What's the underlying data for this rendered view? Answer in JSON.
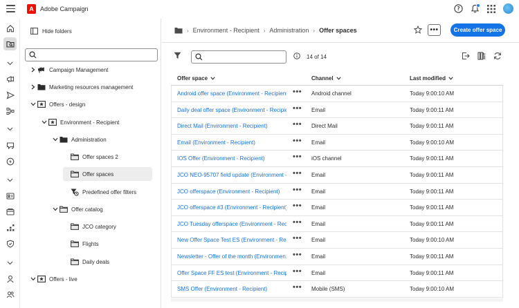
{
  "app": {
    "title": "Adobe Campaign",
    "logo_letter": "A"
  },
  "header_icons": [
    "help-icon",
    "notifications-icon",
    "apps-grid-icon",
    "avatar"
  ],
  "rail": [
    "home-icon",
    "explorer-icon",
    "chevron-down-icon",
    "campaigns-icon",
    "send-icon",
    "journeys-icon",
    "chevron-down-icon",
    "offers-icon",
    "decisioning-icon",
    "chevron-down-icon",
    "profiles-icon",
    "audiences-icon",
    "workflows-icon",
    "security-icon",
    "chevron-down-icon",
    "person-icon",
    "people-icon"
  ],
  "folder_panel": {
    "hide_label": "Hide folders",
    "tree": [
      {
        "label": "Campaign Management",
        "level": 0,
        "expanded": false,
        "icon": "campaign-folder-icon"
      },
      {
        "label": "Marketing resources management",
        "level": 0,
        "expanded": false,
        "icon": "folder-icon"
      },
      {
        "label": "Offers - design",
        "level": 0,
        "expanded": true,
        "icon": "offer-folder-icon"
      },
      {
        "label": "Environment - Recipient",
        "level": 1,
        "expanded": true,
        "icon": "offer-folder-icon"
      },
      {
        "label": "Administration",
        "level": 2,
        "expanded": true,
        "icon": "folder-icon"
      },
      {
        "label": "Offer spaces 2",
        "level": 3,
        "icon": "folder-outline-icon"
      },
      {
        "label": "Offer spaces",
        "level": 3,
        "icon": "folder-outline-icon",
        "selected": true
      },
      {
        "label": "Predefined offer filters",
        "level": 3,
        "icon": "filter-folder-icon"
      },
      {
        "label": "Offer catalog",
        "level": 2,
        "expanded": true,
        "icon": "folder-outline-icon"
      },
      {
        "label": "JCO category",
        "level": 3,
        "icon": "folder-outline-icon"
      },
      {
        "label": "Flights",
        "level": 3,
        "icon": "folder-outline-icon"
      },
      {
        "label": "Daily deals",
        "level": 3,
        "icon": "folder-outline-icon"
      },
      {
        "label": "Offers - live",
        "level": 0,
        "expanded": true,
        "icon": "offer-folder-icon"
      }
    ]
  },
  "breadcrumb": {
    "items": [
      "Environment - Recipient",
      "Administration"
    ],
    "current": "Offer spaces"
  },
  "actions": {
    "more": "•••",
    "create": "Create offer space"
  },
  "toolbar": {
    "count": "14 of 14"
  },
  "table": {
    "columns": [
      "Offer space",
      "Channel",
      "Last modified"
    ],
    "rows": [
      {
        "name": "Android offer space (Environment - Recipient)",
        "channel": "Android channel",
        "modified": "Today 9:00:10 AM"
      },
      {
        "name": "Daily deal offer space (Environment - Recipie...",
        "channel": "Email",
        "modified": "Today 9:00:11 AM"
      },
      {
        "name": "Direct Mail (Environment - Recipient)",
        "channel": "Direct Mail",
        "modified": "Today 9:00:11 AM"
      },
      {
        "name": "Email (Environment - Recipient)",
        "channel": "Email",
        "modified": "Today 9:00:10 AM"
      },
      {
        "name": "IOS Offer (Environment - Recipient)",
        "channel": "iOS channel",
        "modified": "Today 9:00:11 AM"
      },
      {
        "name": "JCO NEO-95707 field update (Environment - ...",
        "channel": "Email",
        "modified": "Today 9:00:11 AM"
      },
      {
        "name": "JCO offerspace (Environment - Recipient)",
        "channel": "Email",
        "modified": "Today 9:00:11 AM"
      },
      {
        "name": "JCO offerspace #3 (Environment - Recipient)",
        "channel": "Email",
        "modified": "Today 9:00:11 AM"
      },
      {
        "name": "JCO Tuesday offerspace (Environment - Recip...",
        "channel": "Email",
        "modified": "Today 9:00:11 AM"
      },
      {
        "name": "New Offer Space Test ES (Environment - Reci...",
        "channel": "Email",
        "modified": "Today 9:00:10 AM"
      },
      {
        "name": "Newsletter - Offer of the month (Environmen...",
        "channel": "Email",
        "modified": "Today 9:00:11 AM"
      },
      {
        "name": "Offer Space FF ES test (Environment - Recipie...",
        "channel": "Email",
        "modified": "Today 9:00:11 AM"
      },
      {
        "name": "SMS Offer (Environment - Recipient)",
        "channel": "Mobile (SMS)",
        "modified": "Today 9:00:10 AM"
      }
    ]
  },
  "colors": {
    "accent": "#1473e6",
    "logo": "#eb1000",
    "link": "#1473e6"
  }
}
